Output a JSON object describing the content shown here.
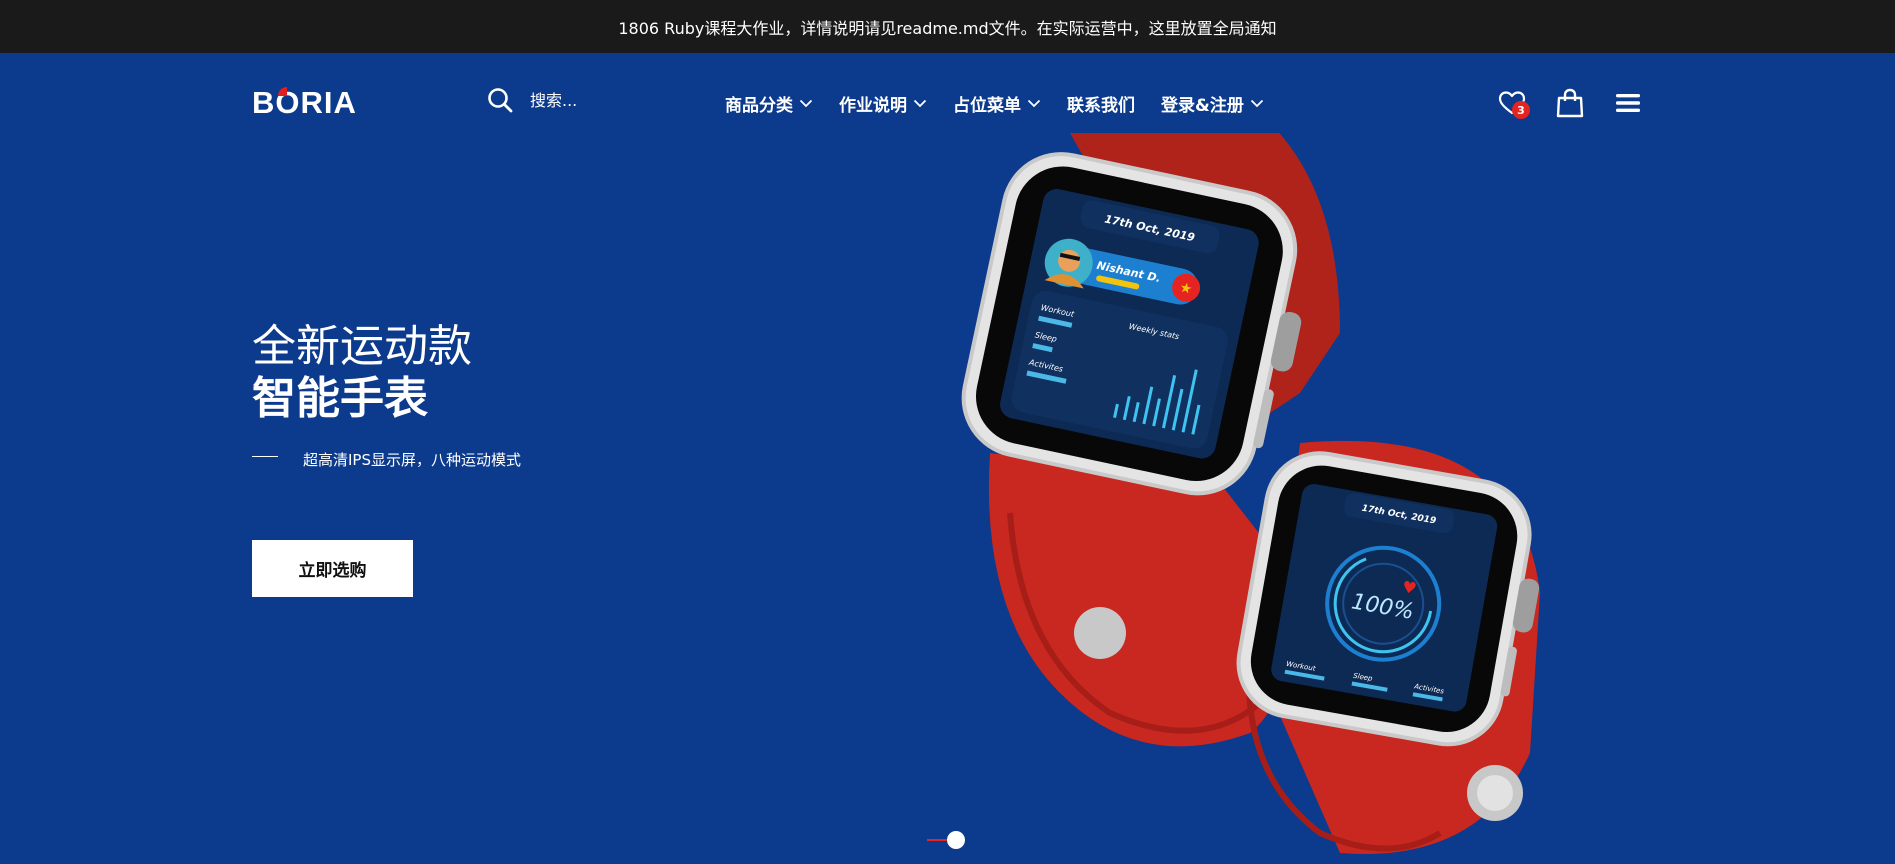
{
  "notice": {
    "text": "1806 Ruby课程大作业，详情说明请见readme.md文件。在实际运营中，这里放置全局通知"
  },
  "header": {
    "logo": {
      "before": "B",
      "o": "O",
      "after": "RIA"
    },
    "search": {
      "placeholder": "搜索...",
      "icon": "search-icon"
    },
    "nav": [
      {
        "label": "商品分类",
        "dropdown": true
      },
      {
        "label": "作业说明",
        "dropdown": true
      },
      {
        "label": "占位菜单",
        "dropdown": true
      },
      {
        "label": "联系我们",
        "dropdown": false
      },
      {
        "label": "登录&注册",
        "dropdown": true
      }
    ],
    "icons": {
      "wishlist": "heart-icon",
      "wishlist_count": "3",
      "cart": "shopping-bag-icon",
      "menu": "hamburger-icon"
    }
  },
  "hero": {
    "title_line1": "全新运动款",
    "title_line2": "智能手表",
    "subtitle": "超高清IPS显示屏，八种运动模式",
    "cta": "立即选购",
    "watch1": {
      "date": "17th Oct, 2019",
      "name": "Nishant D.",
      "labels": [
        "Workout",
        "Sleep",
        "Activites"
      ],
      "stats": "Weekly stats"
    },
    "watch2": {
      "date": "17th Oct, 2019",
      "percent": "100%",
      "labels": [
        "Workout",
        "Sleep",
        "Activites"
      ]
    }
  },
  "slider": {
    "active": 1
  },
  "colors": {
    "notice_bg": "#1a1a1a",
    "hero_bg": "#0c3a8c",
    "accent": "#e52421",
    "strap": "#c8281f"
  }
}
